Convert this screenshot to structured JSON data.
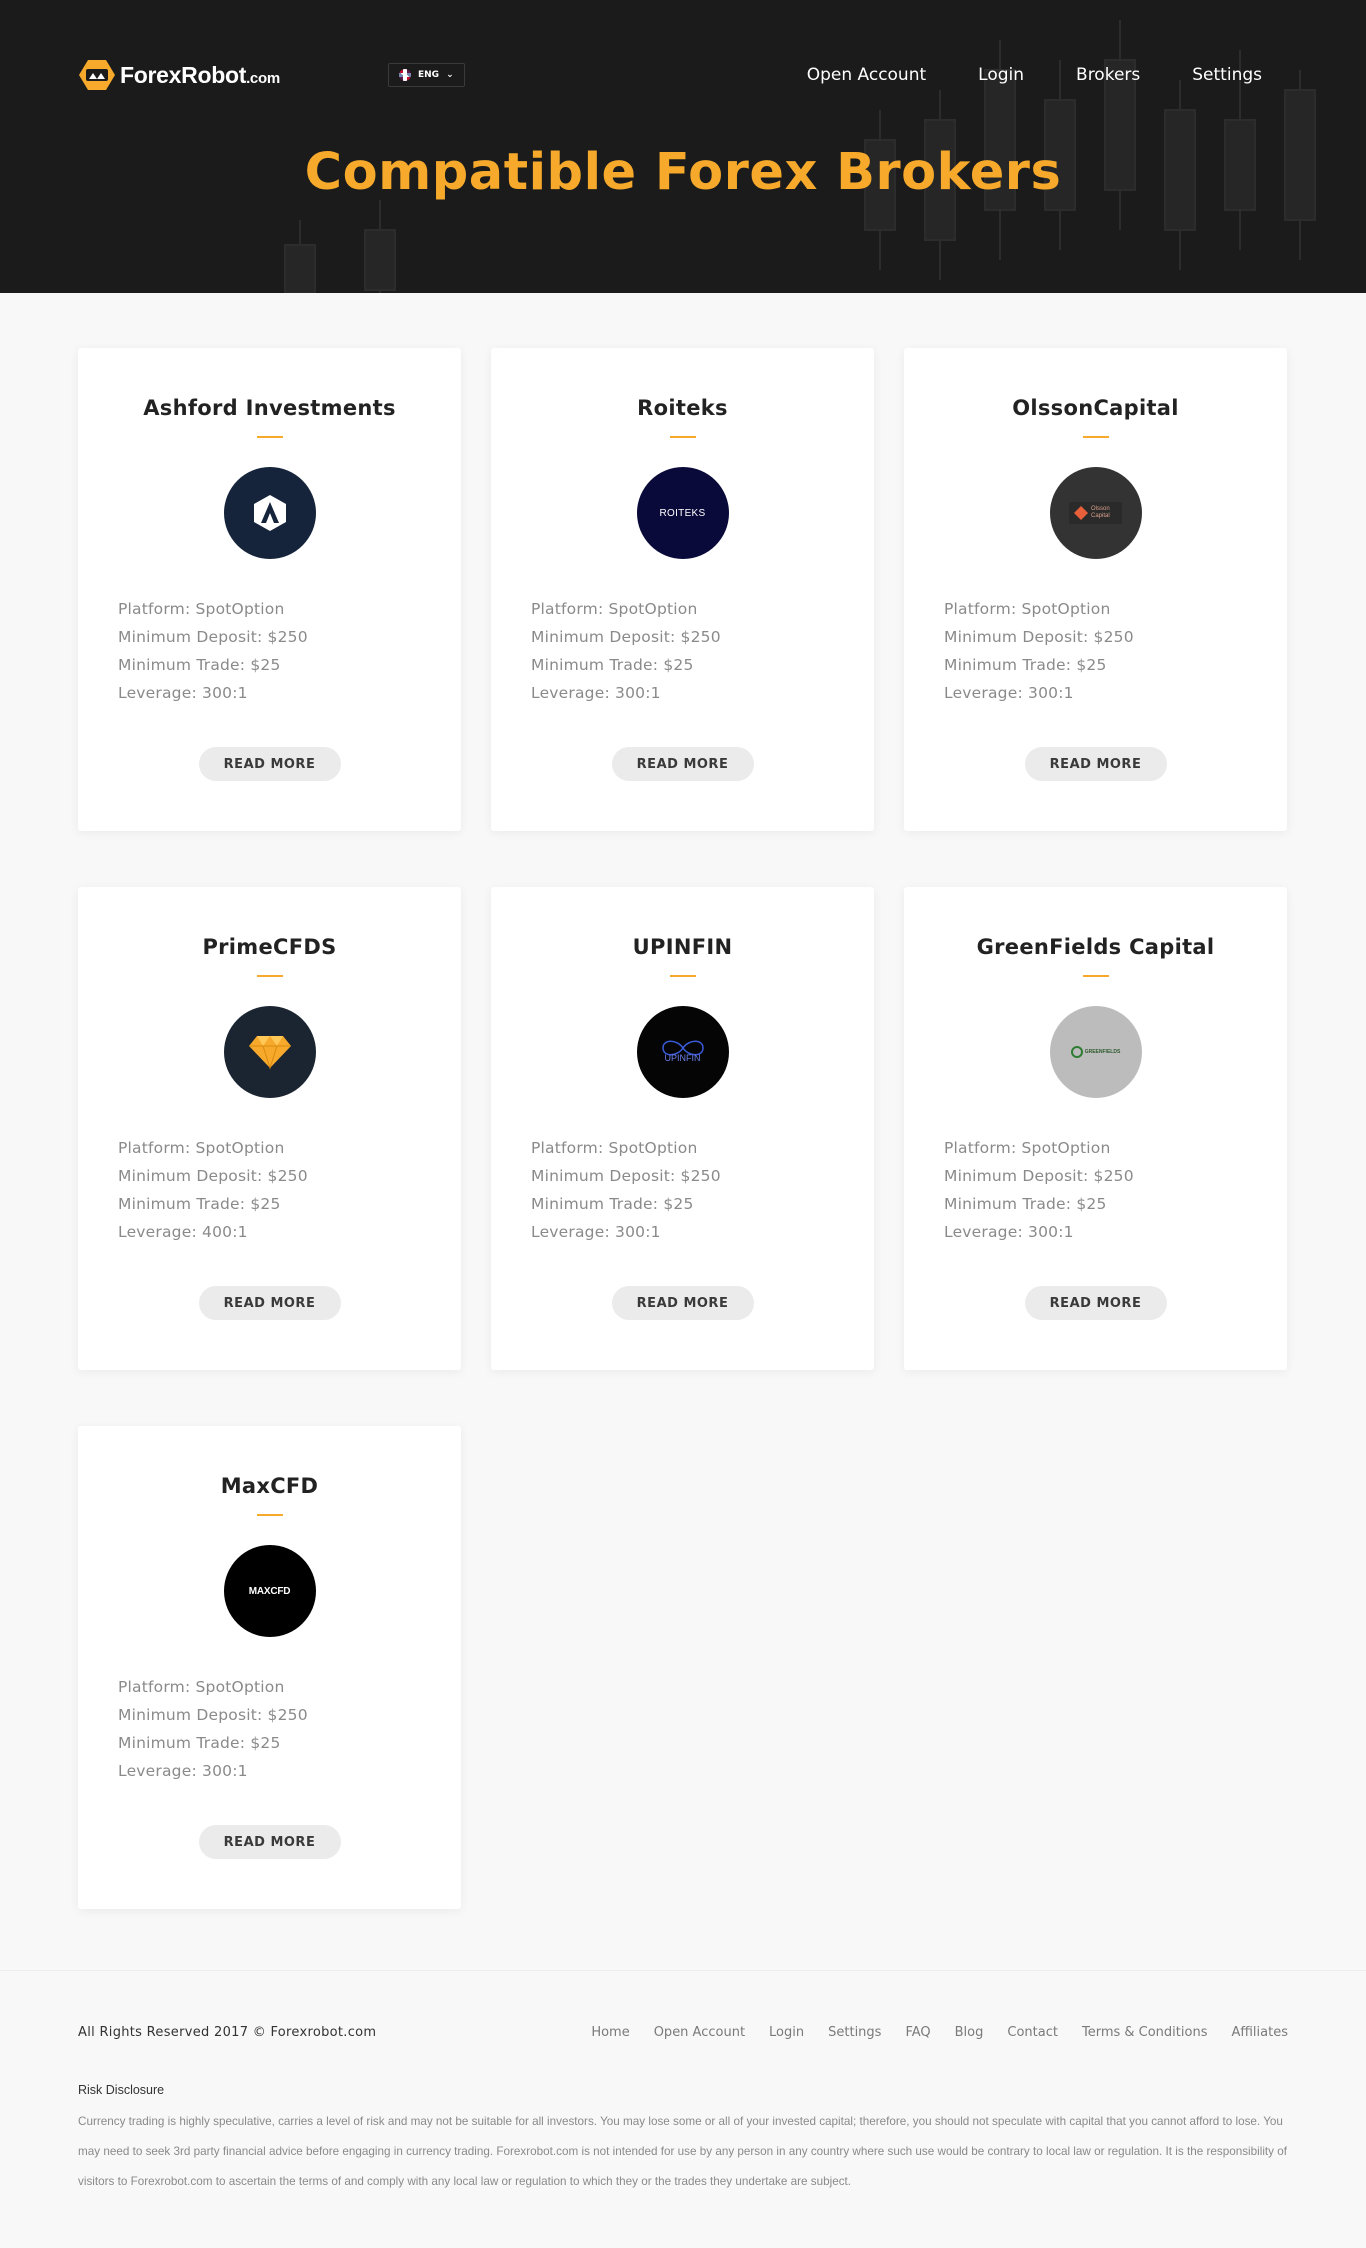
{
  "header": {
    "logo_text": "ForexRobot",
    "logo_suffix": ".com",
    "language": "ENG",
    "menu": [
      "Open Account",
      "Login",
      "Brokers",
      "Settings"
    ],
    "title": "Compatible Forex Brokers"
  },
  "brokers": [
    {
      "name": "Ashford Investments",
      "logo_text": "A",
      "logo_bg": "#15243a",
      "platform": "Platform: SpotOption",
      "deposit": "Minimum Deposit: $250",
      "trade": "Minimum Trade: $25",
      "leverage": "Leverage: 300:1",
      "button": "READ MORE"
    },
    {
      "name": "Roiteks",
      "logo_text": "ROITEKS",
      "logo_bg": "#0a0a3a",
      "platform": "Platform: SpotOption",
      "deposit": "Minimum Deposit: $250",
      "trade": "Minimum Trade: $25",
      "leverage": "Leverage: 300:1",
      "button": "READ MORE"
    },
    {
      "name": "OlssonCapital",
      "logo_text": "Olsson Capital",
      "logo_bg": "#333333",
      "platform": "Platform: SpotOption",
      "deposit": "Minimum Deposit: $250",
      "trade": "Minimum Trade: $25",
      "leverage": "Leverage: 300:1",
      "button": "READ MORE"
    },
    {
      "name": "PrimeCFDS",
      "logo_text": "",
      "logo_bg": "#1b2532",
      "platform": "Platform: SpotOption",
      "deposit": "Minimum Deposit: $250",
      "trade": "Minimum Trade: $25",
      "leverage": "Leverage: 400:1",
      "button": "READ MORE"
    },
    {
      "name": "UPINFIN",
      "logo_text": "UPINFIN",
      "logo_bg": "#050505",
      "platform": "Platform: SpotOption",
      "deposit": "Minimum Deposit: $250",
      "trade": "Minimum Trade: $25",
      "leverage": "Leverage: 300:1",
      "button": "READ MORE"
    },
    {
      "name": "GreenFields Capital",
      "logo_text": "GREENFIELDS",
      "logo_bg": "#bcbcbc",
      "platform": "Platform: SpotOption",
      "deposit": "Minimum Deposit: $250",
      "trade": "Minimum Trade: $25",
      "leverage": "Leverage: 300:1",
      "button": "READ MORE"
    },
    {
      "name": "MaxCFD",
      "logo_text": "MAXCFD",
      "logo_bg": "#000000",
      "platform": "Platform: SpotOption",
      "deposit": "Minimum Deposit: $250",
      "trade": "Minimum Trade: $25",
      "leverage": "Leverage: 300:1",
      "button": "READ MORE"
    }
  ],
  "footer": {
    "copyright": "All Rights Reserved 2017 © Forexrobot.com",
    "links": [
      "Home",
      "Open Account",
      "Login",
      "Settings",
      "FAQ",
      "Blog",
      "Contact",
      "Terms & Conditions",
      "Affiliates"
    ],
    "risk_title": "Risk Disclosure",
    "risk_text": "Currency trading is highly speculative, carries a level of risk and may not be suitable for all investors. You may lose some or all of your invested capital; therefore, you should not speculate with capital that you cannot afford to lose. You may need to seek 3rd party financial advice before engaging in currency trading. Forexrobot.com is not intended for use by any person in any country where such use would be contrary to local law or regulation. It is the responsibility of visitors to Forexrobot.com to ascertain the terms of and comply with any local law or regulation to which they or the trades they undertake are subject."
  },
  "colors": {
    "accent": "#f6a92a",
    "header_bg": "#1b1b1b",
    "page_bg": "#f8f8f8"
  }
}
